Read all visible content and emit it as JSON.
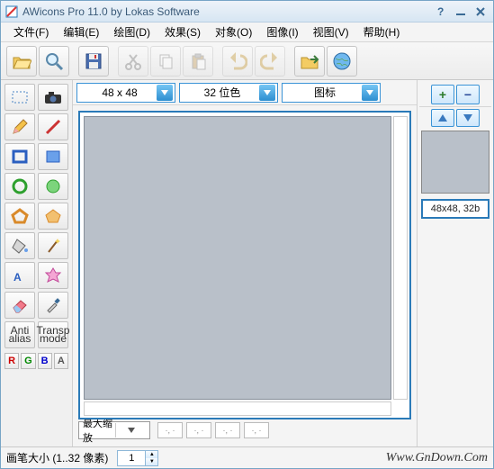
{
  "title": "AWicons Pro 11.0 by Lokas Software",
  "menu": {
    "file": "文件(F)",
    "edit": "编辑(E)",
    "draw": "绘图(D)",
    "effects": "效果(S)",
    "object": "对象(O)",
    "image": "图像(I)",
    "view": "视图(V)",
    "help": "帮助(H)"
  },
  "format": {
    "size": "48 x 48",
    "depth": "32 位色",
    "kind": "图标"
  },
  "zoom": {
    "label": "最大缩放"
  },
  "dots": [
    "·, ·",
    "·, ·",
    "·, ·",
    "·, ·"
  ],
  "status": {
    "brush": "画笔大小 (1..32 像素)",
    "value": "1"
  },
  "right": {
    "info": "48x48, 32b",
    "plus": "+",
    "minus": "−",
    "up": "▲",
    "down": "▼"
  },
  "tools": {
    "antialias1": "Anti",
    "antialias2": "alias",
    "transp1": "Transp",
    "transp2": "mode"
  },
  "rgb": {
    "r": "R",
    "g": "G",
    "b": "B",
    "a": "A"
  },
  "watermark": "Www.GnDown.Com"
}
